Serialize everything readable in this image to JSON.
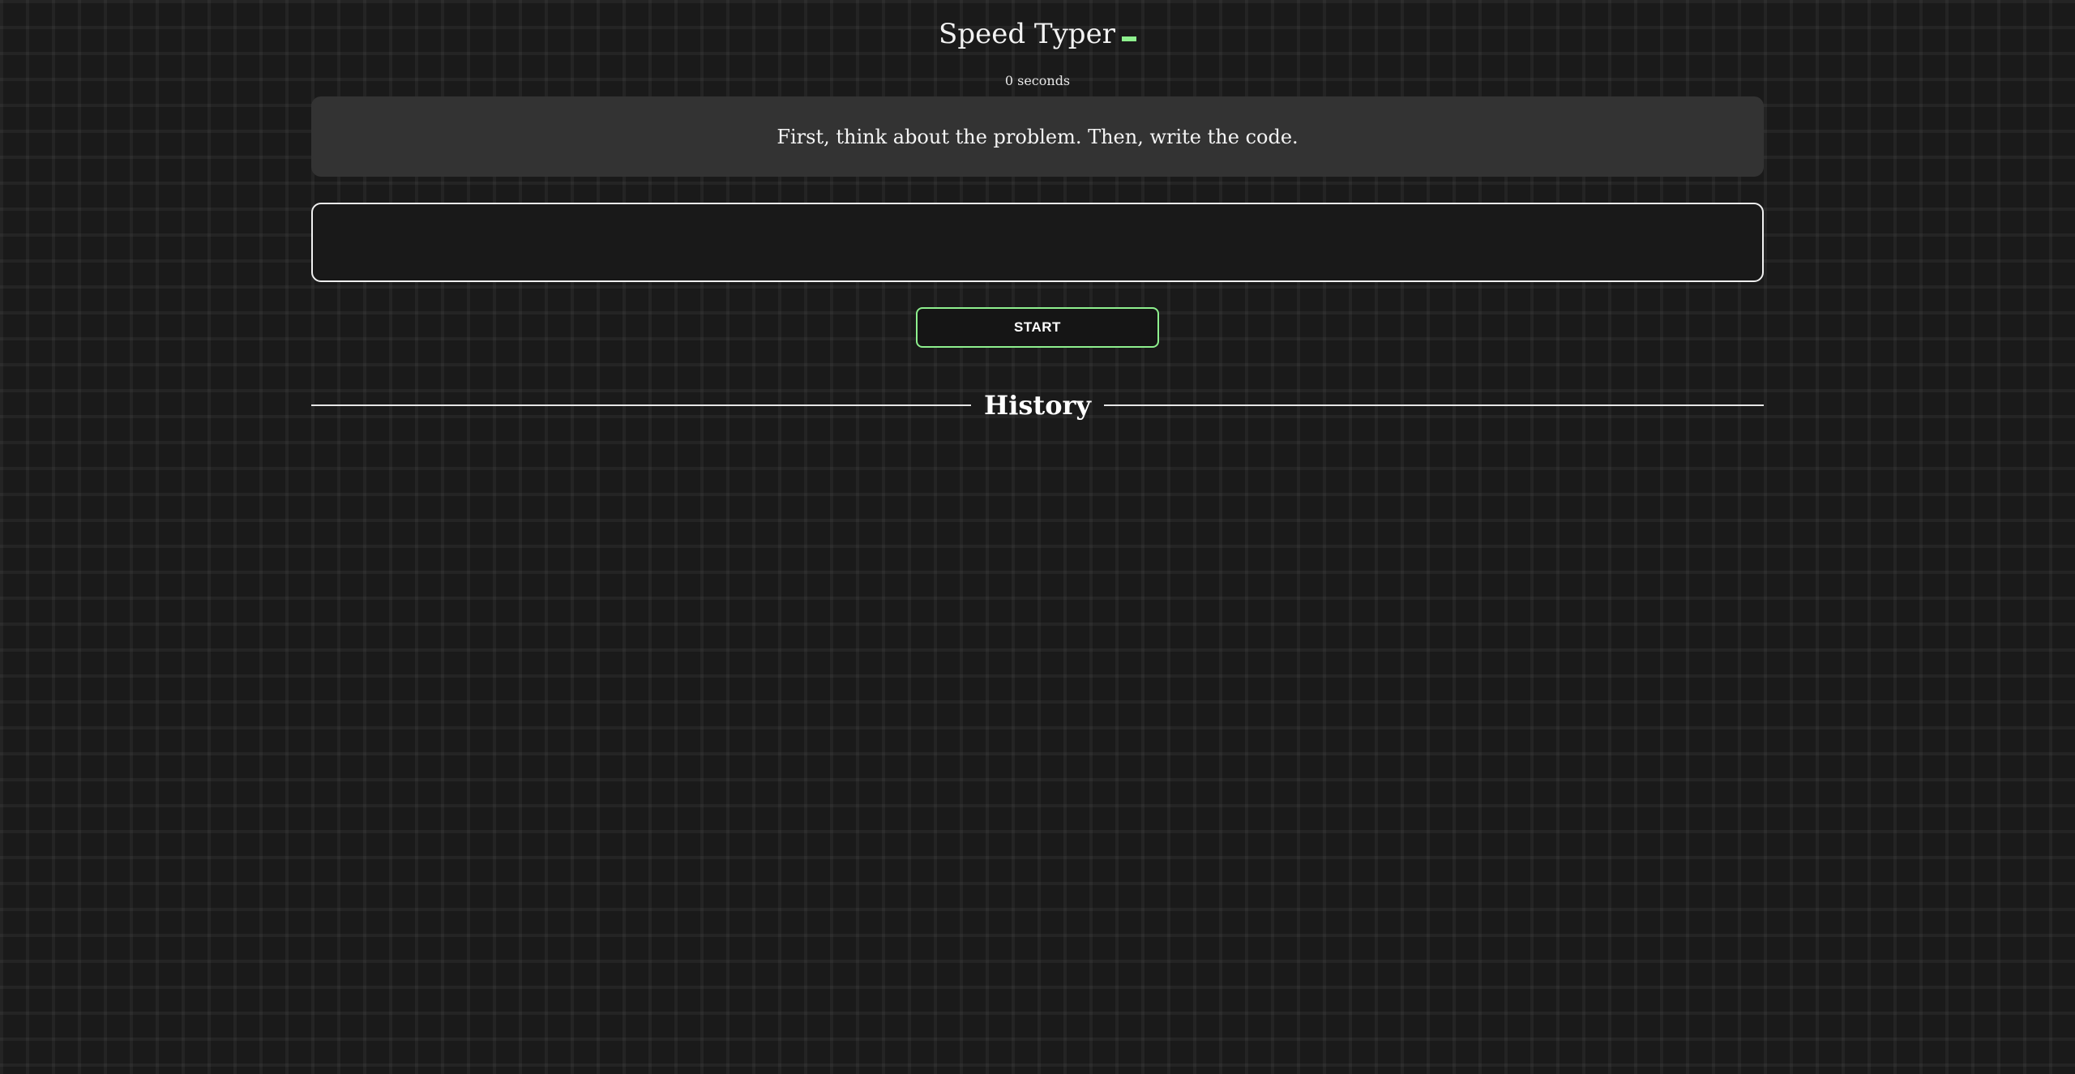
{
  "header": {
    "title": "Speed Typer"
  },
  "timer": {
    "text": "0 seconds"
  },
  "prompt": {
    "text": "First, think about the problem. Then, write the code."
  },
  "typing_input": {
    "value": "",
    "placeholder": ""
  },
  "start_button": {
    "label": "START"
  },
  "history": {
    "title": "History",
    "entries": []
  },
  "colors": {
    "background": "#1a1a1a",
    "accent": "#8ef08e",
    "prompt_background": "#333333",
    "text": "#f4f4f4"
  }
}
